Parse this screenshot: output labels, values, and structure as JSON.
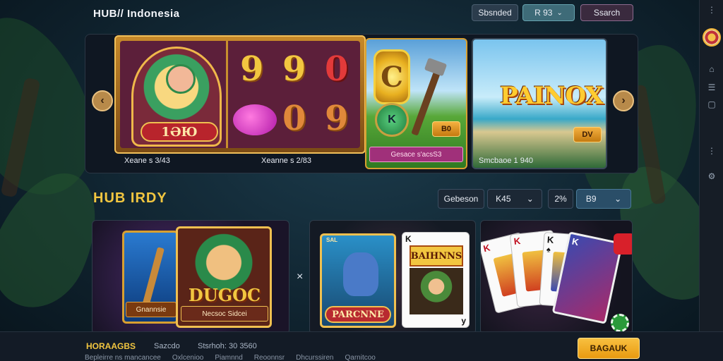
{
  "header": {
    "logo": "HUB// Indonesia",
    "btn_left": "Sbsnded",
    "btn_mid": "R 93",
    "btn_mid_chevron": "⌄",
    "btn_right": "Ssarch"
  },
  "hero": {
    "prev_arrow": "‹",
    "next_arrow": "›",
    "slot": {
      "label": "1ƏЮ",
      "reel_values": [
        "9",
        "9",
        "0",
        "0",
        "9"
      ],
      "caption_left": "Xeane s 3/43",
      "caption_right": "Xeanne s 2/83"
    },
    "game2": {
      "coin_letter": "C",
      "coin2_letter": "K",
      "bet": "B0",
      "label": "Gesace s'acsS3"
    },
    "game3": {
      "title": "PAINOX",
      "bet": "DV",
      "caption": "Smcbaoe 1 940"
    }
  },
  "section": {
    "title": "HUB IRDY",
    "filter_a": "Gebeson",
    "filter_b": "K45",
    "filter_b_chevron": "⌄",
    "filter_c": "2%",
    "filter_d": "B9",
    "filter_d_chevron": "⌄"
  },
  "tiles": {
    "t1": {
      "card_left_label": "Gnannsie",
      "card_right_title": "DUGOC",
      "card_right_label": "Necsoc Sidcei"
    },
    "close": "×",
    "t2": {
      "card_left_title": "PARCNNE",
      "card_left_badge": "SAL",
      "card_right_title": "BAIHNNS",
      "corner_top": "K",
      "corner_bottom": "y"
    },
    "t3": {
      "card_letter": "K",
      "card_suit": "♠"
    }
  },
  "rail": {
    "items": [
      "⋮",
      "⌂",
      "☰",
      "▢",
      "⋮",
      "⚙",
      "●"
    ]
  },
  "footer": {
    "brand": "HORAAGBS",
    "text_1": "Sazcdo",
    "text_2": "Stsrhoh: 30 3560",
    "links": [
      "Bepleirre ns mancancee",
      "Oxlcenioo",
      "Piamnnd",
      "Reoonnsr",
      "Dhcurssiren",
      "Qarnitcoo"
    ],
    "cta": "BAGAUK"
  }
}
